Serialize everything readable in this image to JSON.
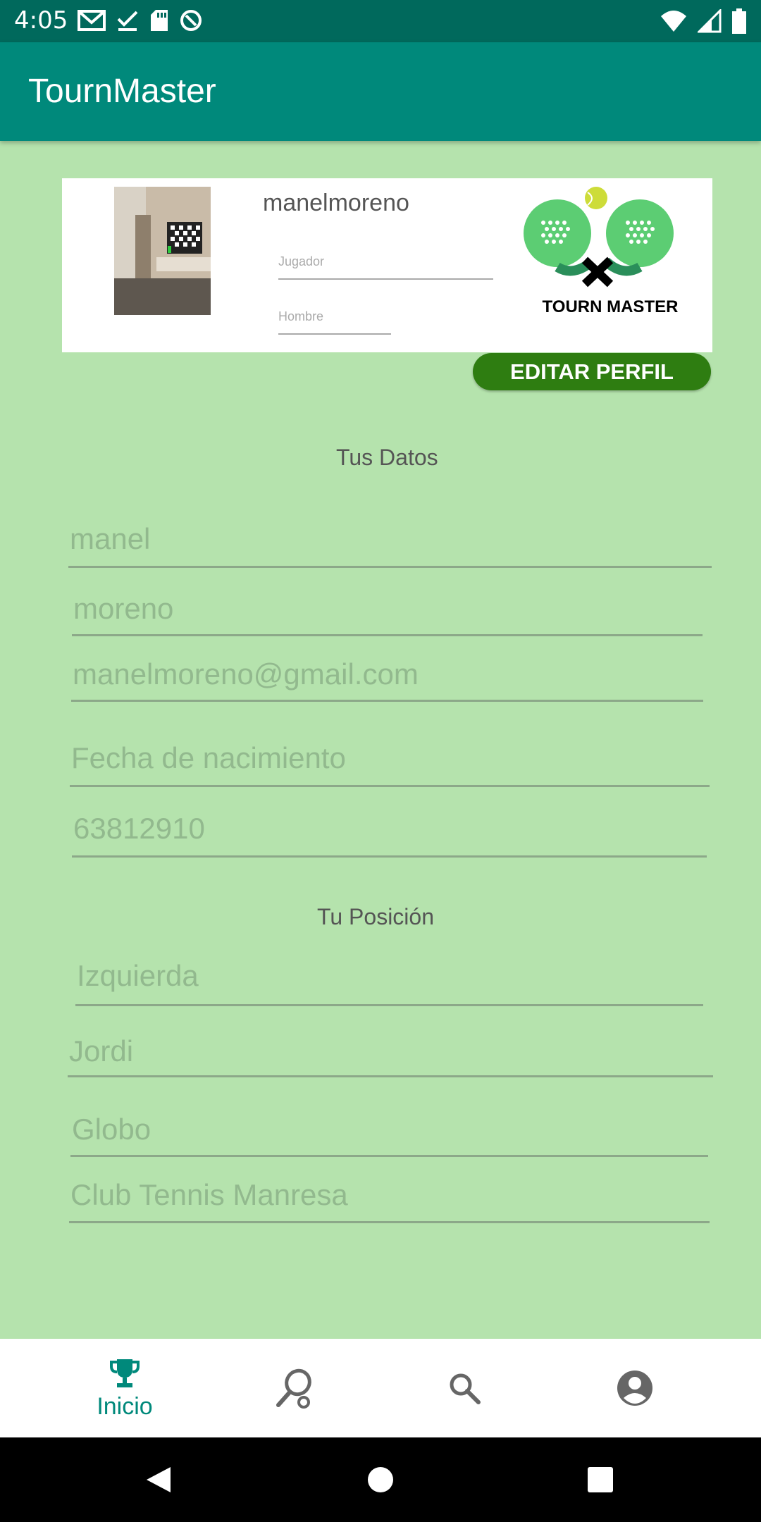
{
  "status": {
    "time": "4:05"
  },
  "app": {
    "title": "TournMaster"
  },
  "profile": {
    "username": "manelmoreno",
    "role_placeholder": "Jugador",
    "gender_placeholder": "Hombre",
    "logo_text": "TOURN MASTER",
    "edit_button": "EDITAR PERFIL"
  },
  "data_section": {
    "title": "Tus Datos",
    "first_name": "manel",
    "last_name": "moreno",
    "email": "manelmoreno@gmail.com",
    "birth_date_placeholder": "Fecha de nacimiento",
    "phone": "63812910"
  },
  "position_section": {
    "title": "Tu Posición",
    "side": "Izquierda",
    "partner": "Jordi",
    "shot": "Globo",
    "club": "Club Tennis Manresa"
  },
  "bottom_nav": {
    "items": [
      {
        "label": "Inicio",
        "icon": "trophy-icon",
        "active": true
      },
      {
        "label": "",
        "icon": "racket-icon"
      },
      {
        "label": "",
        "icon": "search-icon"
      },
      {
        "label": "",
        "icon": "account-icon"
      }
    ]
  },
  "colors": {
    "status_bar": "#00695c",
    "app_bar": "#00897b",
    "background": "#b5e3ad",
    "button": "#2e7d11",
    "field_text": "#92b98e"
  }
}
